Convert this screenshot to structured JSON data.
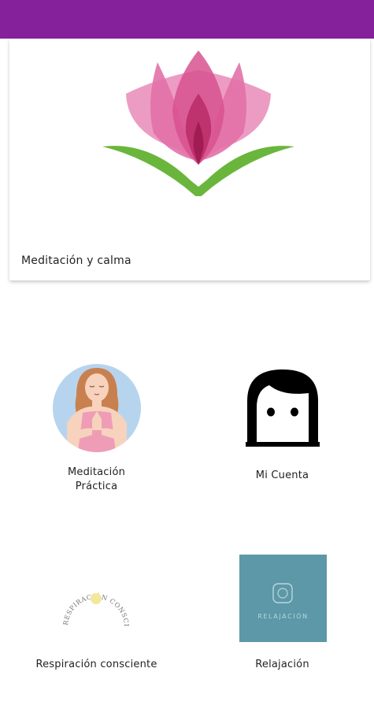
{
  "app": {
    "accent": "#86219c"
  },
  "hero": {
    "title": "Meditación y calma",
    "icon": "lotus-icon"
  },
  "tiles": [
    {
      "label_line1": "Meditación",
      "label_line2": "Práctica",
      "icon": "meditating-woman-icon"
    },
    {
      "label": "Mi Cuenta",
      "icon": "user-face-icon"
    },
    {
      "label": "Respiración consciente",
      "icon": "respiration-logo-icon",
      "logo_text": "RESPIRACIÓN CONSCIENTE"
    },
    {
      "label": "Relajación",
      "icon": "relaxation-logo-icon",
      "logo_text": "RELAJACIÓN"
    }
  ]
}
